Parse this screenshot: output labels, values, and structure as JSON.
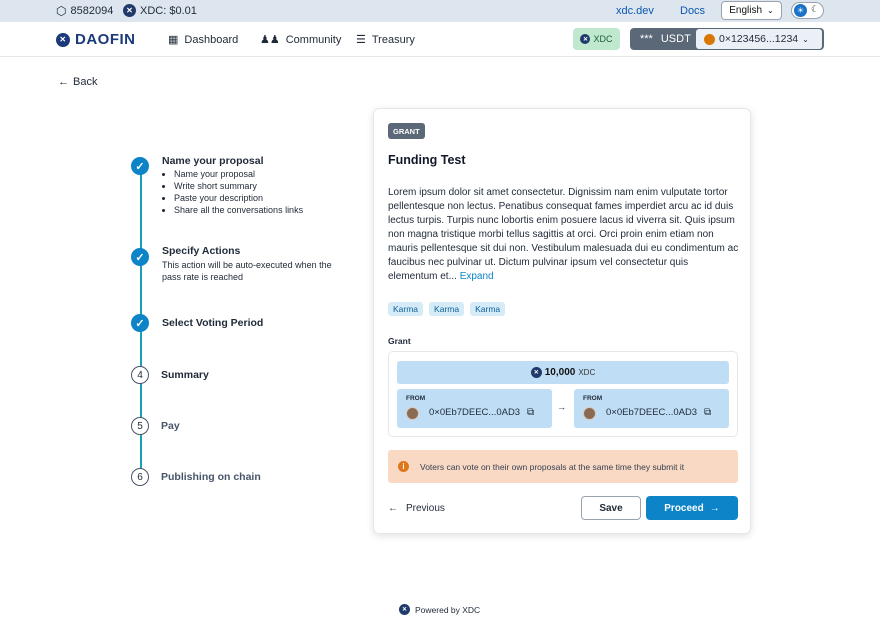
{
  "topbar": {
    "block_number": "8582094",
    "price": "XDC: $0.01",
    "link_site": "xdc.dev",
    "link_docs": "Docs",
    "language": "English"
  },
  "nav": {
    "brand": "DAOFIN",
    "items": [
      {
        "label": "Dashboard"
      },
      {
        "label": "Community"
      },
      {
        "label": "Treasury"
      }
    ],
    "network_chip": "XDC",
    "balance_mask": "***",
    "balance_unit": "USDT",
    "wallet_address": "0×123456...1234"
  },
  "back_label": "Back",
  "steps": [
    {
      "title": "Name your proposal",
      "number": "",
      "status": "done",
      "subitems": [
        "Name your proposal",
        "Write short summary",
        "Paste your description",
        "Share all the conversations links"
      ]
    },
    {
      "title": "Specify Actions",
      "number": "",
      "status": "done",
      "description": "This action will be auto-executed when the pass rate is reached"
    },
    {
      "title": "Select Voting Period",
      "number": "",
      "status": "done"
    },
    {
      "title": "Summary",
      "number": "4",
      "status": "current"
    },
    {
      "title": "Pay",
      "number": "5",
      "status": "todo"
    },
    {
      "title": "Publishing on chain",
      "number": "6",
      "status": "todo"
    }
  ],
  "proposal": {
    "badge": "GRANT",
    "title": "Funding Test",
    "description": "Lorem ipsum dolor sit amet consectetur. Dignissim nam enim vulputate tortor pellentesque non lectus. Penatibus consequat fames imperdiet arcu ac id duis lectus turpis. Turpis nunc lobortis enim posuere lacus id viverra sit. Quis ipsum non magna tristique morbi tellus sagittis at orci. Orci proin enim etiam non mauris pellentesque sit dui non. Vestibulum malesuada dui eu condimentum ac faucibus nec pulvinar ut. Dictum pulvinar ipsum vel consectetur quis elementum et...",
    "expand_label": "Expand",
    "tags": [
      "Karma",
      "Karma",
      "Karma"
    ],
    "grant_label": "Grant",
    "amount": "10,000",
    "amount_unit": "XDC",
    "parties": [
      {
        "label": "FROM",
        "address": "0×0Eb7DEEC...0AD3"
      },
      {
        "label": "FROM",
        "address": "0×0Eb7DEEC...0AD3"
      }
    ],
    "notice": "Voters can vote on their own proposals at the same time they submit it",
    "prev_label": "Previous",
    "save_label": "Save",
    "proceed_label": "Proceed"
  },
  "footer": {
    "label": "Powered by XDC"
  },
  "colors": {
    "primary": "#0d84c8",
    "step_line": "#18a0b6",
    "notice_bg": "#f9d9c4",
    "chip_bg": "#bfdef6"
  }
}
